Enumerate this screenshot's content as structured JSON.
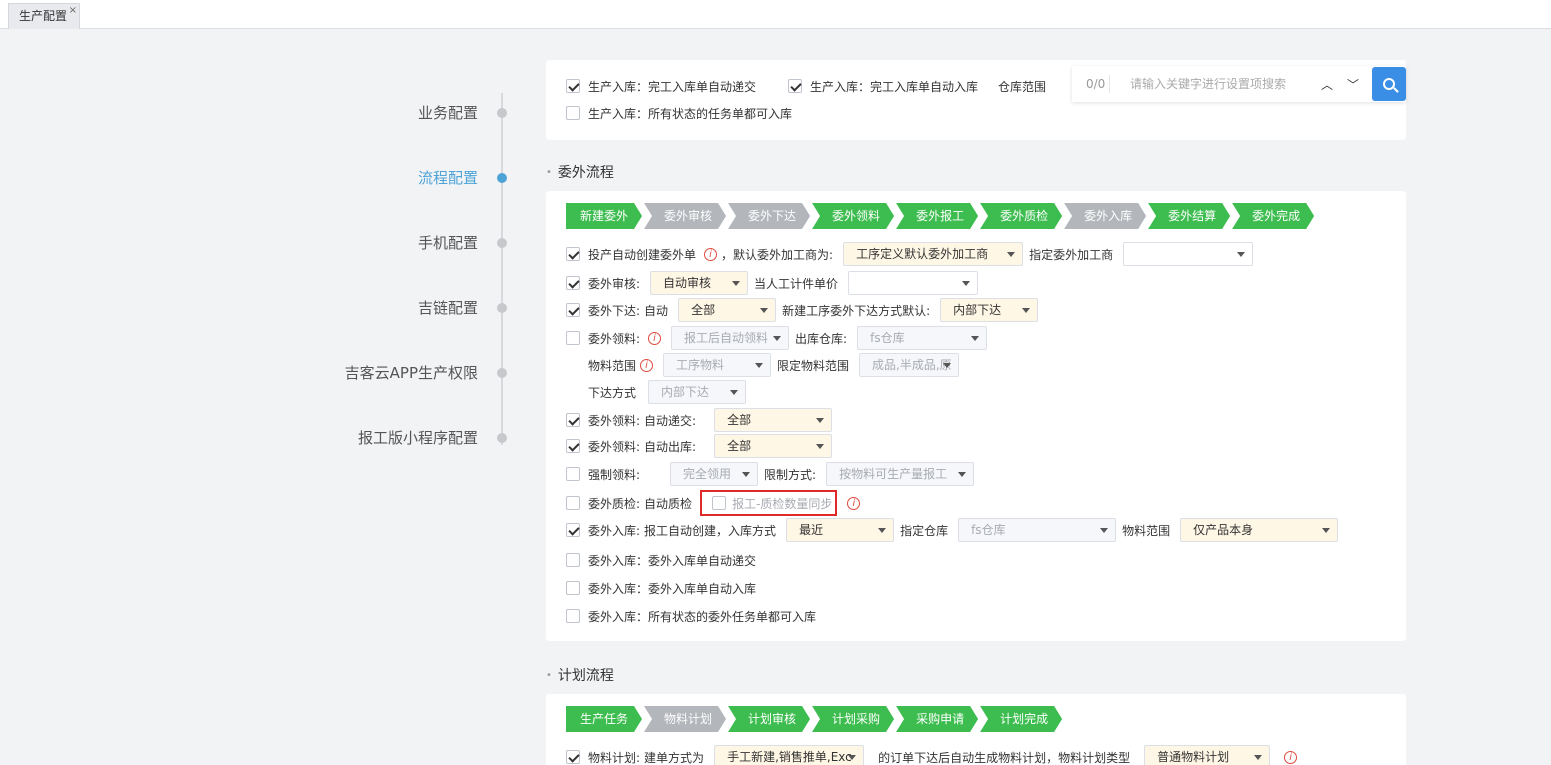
{
  "tab": {
    "label": "生产配置",
    "close": "×"
  },
  "nav": [
    {
      "label": "业务配置",
      "active": false
    },
    {
      "label": "流程配置",
      "active": true
    },
    {
      "label": "手机配置",
      "active": false
    },
    {
      "label": "吉链配置",
      "active": false
    },
    {
      "label": "吉客云APP生产权限",
      "active": false
    },
    {
      "label": "报工版小程序配置",
      "active": false
    }
  ],
  "search": {
    "count": "0/0",
    "placeholder": "请输入关键字进行设置项搜索",
    "up": "︿",
    "down": "﹀"
  },
  "top_card": {
    "row1_a": "生产入库：完工入库单自动递交",
    "row1_b": "生产入库：完工入库单自动入库",
    "row1_c": "仓库范围",
    "row2": "生产入库：所有状态的任务单都可入库"
  },
  "outsource": {
    "title": "委外流程",
    "steps": [
      {
        "label": "新建委外",
        "done": true
      },
      {
        "label": "委外审核",
        "done": false
      },
      {
        "label": "委外下达",
        "done": false
      },
      {
        "label": "委外领料",
        "done": true
      },
      {
        "label": "委外报工",
        "done": true
      },
      {
        "label": "委外质检",
        "done": true
      },
      {
        "label": "委外入库",
        "done": false
      },
      {
        "label": "委外结算",
        "done": true
      },
      {
        "label": "委外完成",
        "done": true
      }
    ],
    "r1": {
      "label": "投产自动创建委外单",
      "mid": "，默认委外加工商为:",
      "sel1": "工序定义默认委外加工商",
      "mid2": "指定委外加工商",
      "sel2": ""
    },
    "r2": {
      "label": "委外审核:",
      "sel1": "自动审核",
      "mid": "当人工计件单价",
      "sel2": ""
    },
    "r3": {
      "label": "委外下达:",
      "mid": "自动",
      "sel1": "全部",
      "mid2": "新建工序委外下达方式默认:",
      "sel2": "内部下达"
    },
    "r4": {
      "label": "委外领料:",
      "sel1": "报工后自动领料",
      "mid": "出库仓库:",
      "sel2": "fs仓库"
    },
    "r5": {
      "label": "物料范围",
      "sel1": "工序物料",
      "mid": "限定物料范围",
      "sel2": "成品,半成品,原"
    },
    "r6": {
      "label": "下达方式",
      "sel1": "内部下达"
    },
    "r7": {
      "label": "委外领料:",
      "mid": "自动递交:",
      "sel1": "全部"
    },
    "r8": {
      "label": "委外领料:",
      "mid": "自动出库:",
      "sel1": "全部"
    },
    "r9": {
      "label": "强制领料:",
      "sel1": "完全领用",
      "mid": "限制方式:",
      "sel2": "按物料可生产量报工"
    },
    "r10": {
      "label": "委外质检:",
      "mid": "自动质检",
      "box": "报工-质检数量同步"
    },
    "r11": {
      "label": "委外入库:",
      "mid": "报工自动创建，入库方式",
      "sel1": "最近",
      "mid2": "指定仓库",
      "sel2": "fs仓库",
      "mid3": "物料范围",
      "sel3": "仅产品本身"
    },
    "r12": "委外入库：委外入库单自动递交",
    "r13": "委外入库：委外入库单自动入库",
    "r14": "委外入库：所有状态的委外任务单都可入库"
  },
  "plan": {
    "title": "计划流程",
    "steps": [
      {
        "label": "生产任务",
        "done": true
      },
      {
        "label": "物料计划",
        "done": false
      },
      {
        "label": "计划审核",
        "done": true
      },
      {
        "label": "计划采购",
        "done": true
      },
      {
        "label": "采购申请",
        "done": true
      },
      {
        "label": "计划完成",
        "done": true
      }
    ],
    "r1": {
      "label": "物料计划:",
      "mid": "建单方式为",
      "sel1": "手工新建,销售推单,Exc",
      "mid2": "的订单下达后自动生成物料计划，物料计划类型",
      "sel2": "普通物料计划"
    }
  },
  "info_glyph": "i",
  "colors": {
    "accent": "#4ea3d6",
    "green_step": "#3dbd4f",
    "gray_step": "#b3b6bb",
    "search_btn": "#3a8ee6",
    "highlight": "#e02a2a"
  }
}
